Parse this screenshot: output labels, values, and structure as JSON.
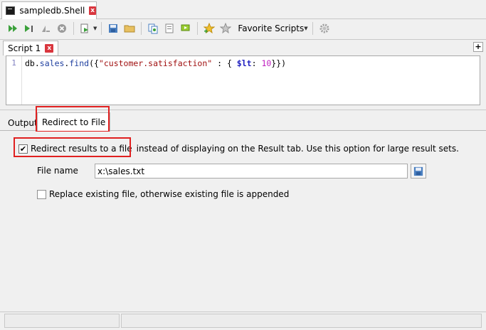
{
  "doc_tab": {
    "title": "sampledb.Shell",
    "close": "x"
  },
  "toolbar": {
    "icons": [
      "run-all-icon",
      "run-selected-icon",
      "step-icon",
      "stop-icon",
      "run-menu-icon",
      "save-icon",
      "open-folder-icon",
      "copy-icon",
      "paste-icon",
      "flag-icon",
      "add-favorite-icon",
      "favorite-icon",
      "settings-icon"
    ],
    "favorite_scripts_label": "Favorite Scripts"
  },
  "editor": {
    "tab_label": "Script 1",
    "tab_close": "x",
    "add_tab": "+",
    "line_number": "1",
    "code": {
      "t1": "db",
      "t2": ".",
      "t3": "sales",
      "t4": ".",
      "t5": "find",
      "t6": "({",
      "t7": "\"customer.satisfaction\"",
      "t8": " : { ",
      "t9": "$lt",
      "t10": ": ",
      "t11": "10",
      "t12": "}})"
    }
  },
  "output_tabs": {
    "output": "Output",
    "redirect": "Redirect to File"
  },
  "redirect_panel": {
    "redirect_checkbox_checked": true,
    "redirect_label": "Redirect results to a file",
    "redirect_description": "instead of displaying on the Result tab. Use this option for large result sets.",
    "file_name_label": "File name",
    "file_name_value": "x:\\sales.txt",
    "replace_checkbox_checked": false,
    "replace_label": "Replace existing file, otherwise existing file is appended"
  },
  "colors": {
    "highlight": "#e02020",
    "checkmark": "#000000"
  }
}
